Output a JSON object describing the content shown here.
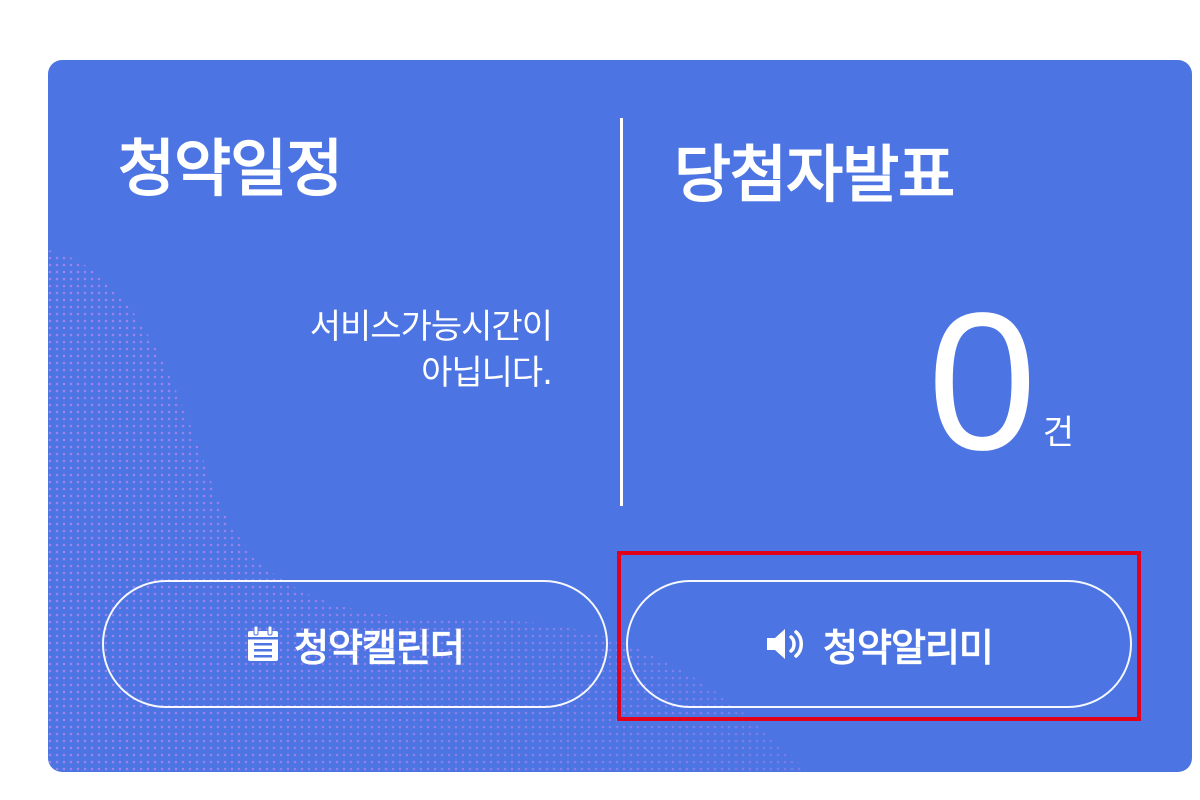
{
  "card": {
    "left_title": "청약일정",
    "right_title": "당첨자발표",
    "notice_line1": "서비스가능시간이",
    "notice_line2": "아닙니다.",
    "count": "0",
    "count_unit": "건"
  },
  "buttons": {
    "calendar_label": "청약캘린더",
    "calendar_icon": "calendar-icon",
    "alert_label": "청약알리미",
    "alert_icon": "speaker-icon"
  },
  "colors": {
    "card_background": "#4c74e3",
    "text": "#ffffff",
    "highlight_box": "#e3001b",
    "wave_dots": "#c48bf0"
  }
}
